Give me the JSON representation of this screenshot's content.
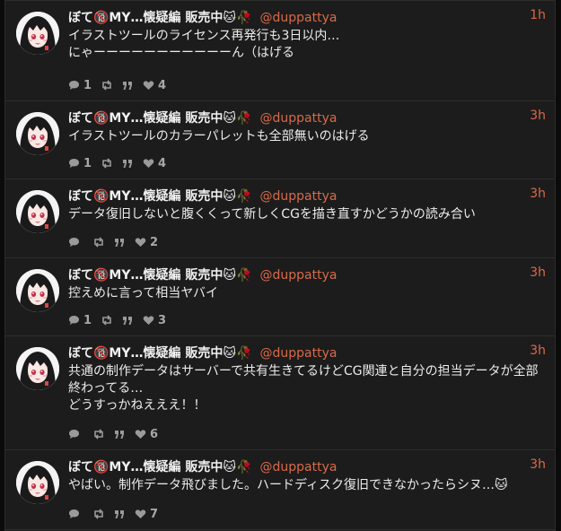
{
  "posts": [
    {
      "name": "ぼて🔞MY…懐疑編 販売中🐱🥀",
      "handle": "@duppattya",
      "time": "1h",
      "text": "イラストツールのライセンス再発行も3日以内…\nにゃーーーーーーーーーーーん（はげる",
      "replies": "1",
      "likes": "4"
    },
    {
      "name": "ぼて🔞MY…懐疑編 販売中🐱🥀",
      "handle": "@duppattya",
      "time": "3h",
      "text": "イラストツールのカラーパレットも全部無いのはげる",
      "replies": "1",
      "likes": "4"
    },
    {
      "name": "ぼて🔞MY…懐疑編 販売中🐱🥀",
      "handle": "@duppattya",
      "time": "3h",
      "text": "データ復旧しないと腹くくって新しくCGを描き直すかどうかの読み合い",
      "replies": "",
      "likes": "2"
    },
    {
      "name": "ぼて🔞MY…懐疑編 販売中🐱🥀",
      "handle": "@duppattya",
      "time": "3h",
      "text": "控えめに言って相当ヤバイ",
      "replies": "1",
      "likes": "3"
    },
    {
      "name": "ぼて🔞MY…懐疑編 販売中🐱🥀",
      "handle": "@duppattya",
      "time": "3h",
      "text": "共通の制作データはサーバーで共有生きてるけどCG関連と自分の担当データが全部終わってる…\nどうすっかねえええ！！",
      "replies": "",
      "likes": "6"
    },
    {
      "name": "ぼて🔞MY…懐疑編 販売中🐱🥀",
      "handle": "@duppattya",
      "time": "3h",
      "text": "やばい。制作データ飛びました。ハードディスク復旧できなかったらシヌ…🐱",
      "replies": "",
      "likes": "7"
    }
  ],
  "icons": {
    "reply": "reply-icon",
    "boost": "boost-icon",
    "quote": "quote-icon",
    "like": "heart-icon"
  },
  "colors": {
    "background": "#1c1c1c",
    "accent": "#d86a4a",
    "text": "#ececec",
    "muted": "#9a9a9a"
  }
}
